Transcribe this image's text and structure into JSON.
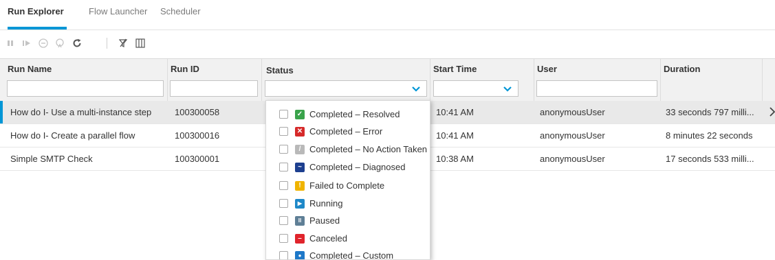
{
  "tabs": [
    {
      "label": "Run Explorer",
      "active": true
    },
    {
      "label": "Flow Launcher",
      "active": false
    },
    {
      "label": "Scheduler",
      "active": false
    }
  ],
  "toolbar": {
    "icons": [
      "pause-icon",
      "resume-icon",
      "cancel-icon",
      "reassign-icon",
      "refresh-icon",
      "filter-icon",
      "columns-icon"
    ]
  },
  "columns": [
    {
      "title": "Run Name"
    },
    {
      "title": "Run ID"
    },
    {
      "title": "Status"
    },
    {
      "title": "Start Time"
    },
    {
      "title": "User"
    },
    {
      "title": "Duration"
    }
  ],
  "filters": {
    "run_name": "",
    "run_id": "",
    "status": "",
    "start_time": "",
    "user": ""
  },
  "rows": [
    {
      "run_name": "How do I- Use a multi-instance step",
      "run_id": "100300058",
      "start_time": "10:41 AM",
      "user": "anonymousUser",
      "duration": "33 seconds 797 milli...",
      "selected": true
    },
    {
      "run_name": "How do I- Create a parallel flow",
      "run_id": "100300016",
      "start_time": "10:41 AM",
      "user": "anonymousUser",
      "duration": "8 minutes 22 seconds",
      "selected": false
    },
    {
      "run_name": "Simple SMTP Check",
      "run_id": "100300001",
      "start_time": "10:38 AM",
      "user": "anonymousUser",
      "duration": "17 seconds 533 milli...",
      "selected": false
    }
  ],
  "status_dropdown": {
    "options": [
      {
        "label": "Completed – Resolved",
        "icon": "resolved-check-icon",
        "color": "#3aa34b",
        "glyph": "✓",
        "checked": false
      },
      {
        "label": "Completed – Error",
        "icon": "error-x-icon",
        "color": "#d62a2a",
        "glyph": "✕",
        "checked": false
      },
      {
        "label": "Completed – No Action Taken",
        "icon": "no-action-icon",
        "color": "#b9b9b9",
        "glyph": "/",
        "checked": false
      },
      {
        "label": "Completed – Diagnosed",
        "icon": "diagnosed-icon",
        "color": "#1d3f8f",
        "glyph": "~",
        "checked": false
      },
      {
        "label": "Failed to Complete",
        "icon": "failed-warning-icon",
        "color": "#f0b400",
        "glyph": "!",
        "checked": false
      },
      {
        "label": "Running",
        "icon": "running-play-icon",
        "color": "#1e88c8",
        "glyph": "▶",
        "checked": false
      },
      {
        "label": "Paused",
        "icon": "paused-icon",
        "color": "#5f7f96",
        "glyph": "II",
        "checked": false
      },
      {
        "label": "Canceled",
        "icon": "canceled-icon",
        "color": "#e0242c",
        "glyph": "–",
        "checked": false
      },
      {
        "label": "Completed – Custom",
        "icon": "custom-user-icon",
        "color": "#1e78c8",
        "glyph": "●",
        "checked": false
      }
    ]
  },
  "colors": {
    "accent": "#0096d6",
    "header_bg": "#f1f1f1",
    "selected_row_bg": "#e9e9e9"
  }
}
